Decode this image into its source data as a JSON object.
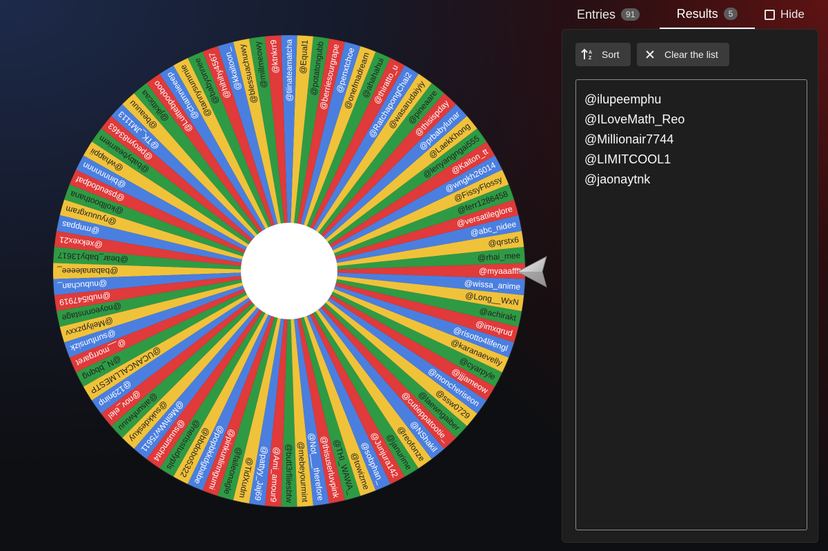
{
  "tabs": {
    "entries_label": "Entries",
    "entries_count": "91",
    "results_label": "Results",
    "results_count": "5",
    "hide_label": "Hide"
  },
  "toolbar": {
    "sort_label": "Sort",
    "clear_label": "Clear the list"
  },
  "results": [
    "@ilupeemphu",
    "@ILoveMath_Reo",
    "@Millionair7744",
    "@LIMITCOOL1",
    "@jaonaytnk"
  ],
  "wheel": {
    "colors": [
      "#e03a3a",
      "#2f9a44",
      "#f0c23a",
      "#4a7fe0"
    ],
    "labels": [
      "@myaaaffft",
      "@rhai_mee",
      "@qrstx6",
      "@abc_nidee",
      "@versatileglore",
      "@ferr1286458",
      "@FissyFlossy",
      "@wngkh26014",
      "@Kaiton_tt",
      "@lenyangngai555",
      "@LaekKhong",
      "@prbabylunar",
      "@thisispday",
      "@pineaare",
      "@wasarudaiyiy",
      "@RatchapongChai2",
      "@thiratto_u",
      "@ahahahui",
      "@onefmadream",
      "@penxtchoe",
      "@berriesourgrape",
      "@potatongubb",
      "@Equal1",
      "@tiinateamatcha",
      "@ktnkrr9",
      "@millmeowy",
      "@blessuachuwy",
      "@kkaitoon_",
      "@hihihy4567",
      "@babyonnee",
      "@tannysummie",
      "@chamnieeep",
      "@Luittebpooboo",
      "@jlkitticaa",
      "@beauuu",
      "@TK_JM1113",
      "@peoyn83463",
      "@babybearriem",
      "@whappii",
      "@binnnnnnn",
      "@pseudodpaf",
      "@kollboothana",
      "@ryuuuxgram",
      "@mnppas",
      "@xekxex21",
      "@bear_baby13617",
      "@babanaleeee_",
      "@nubuchan_",
      "@nubi547919",
      "@noyeonnstage",
      "@Meilypzxxv",
      "@sunfunsizk",
      "@__morrgaret",
      "@N_bbqng",
      "@UCANCALLMESTP",
      "@129ninp",
      "@nov_elel",
      "@aisunfwuuu",
      "@sukkdeskuy",
      "@MeihWw75611",
      "@suusmcht4",
      "@nerisstudypls",
      "@bbdobo5322",
      "@popbkkdgbabe",
      "@pinkunlinngumi",
      "@faileonagle",
      "@TidXudm",
      "@pattyy_Jaj69",
      "@Ami_amour9",
      "@butt3rfliiesbtw",
      "@mebeyourmint",
      "@Not___therefore",
      "@thisuserluvpink",
      "@THI_WAWA_",
      "@towizme",
      "@sobphan_",
      "@Junjura142",
      "@janurime",
      "@reofonze",
      "@NShakil",
      "@cutieppatootie_",
      "@laewngaiber",
      "@ssw0729",
      "@moncheriseon",
      "@jjjameow",
      "@cyarpyle",
      "@karanaevelly",
      "@risotto4lifengl",
      "@imxqrud",
      "@achirakt",
      "@Long__WxN",
      "@wissa_anime"
    ]
  }
}
